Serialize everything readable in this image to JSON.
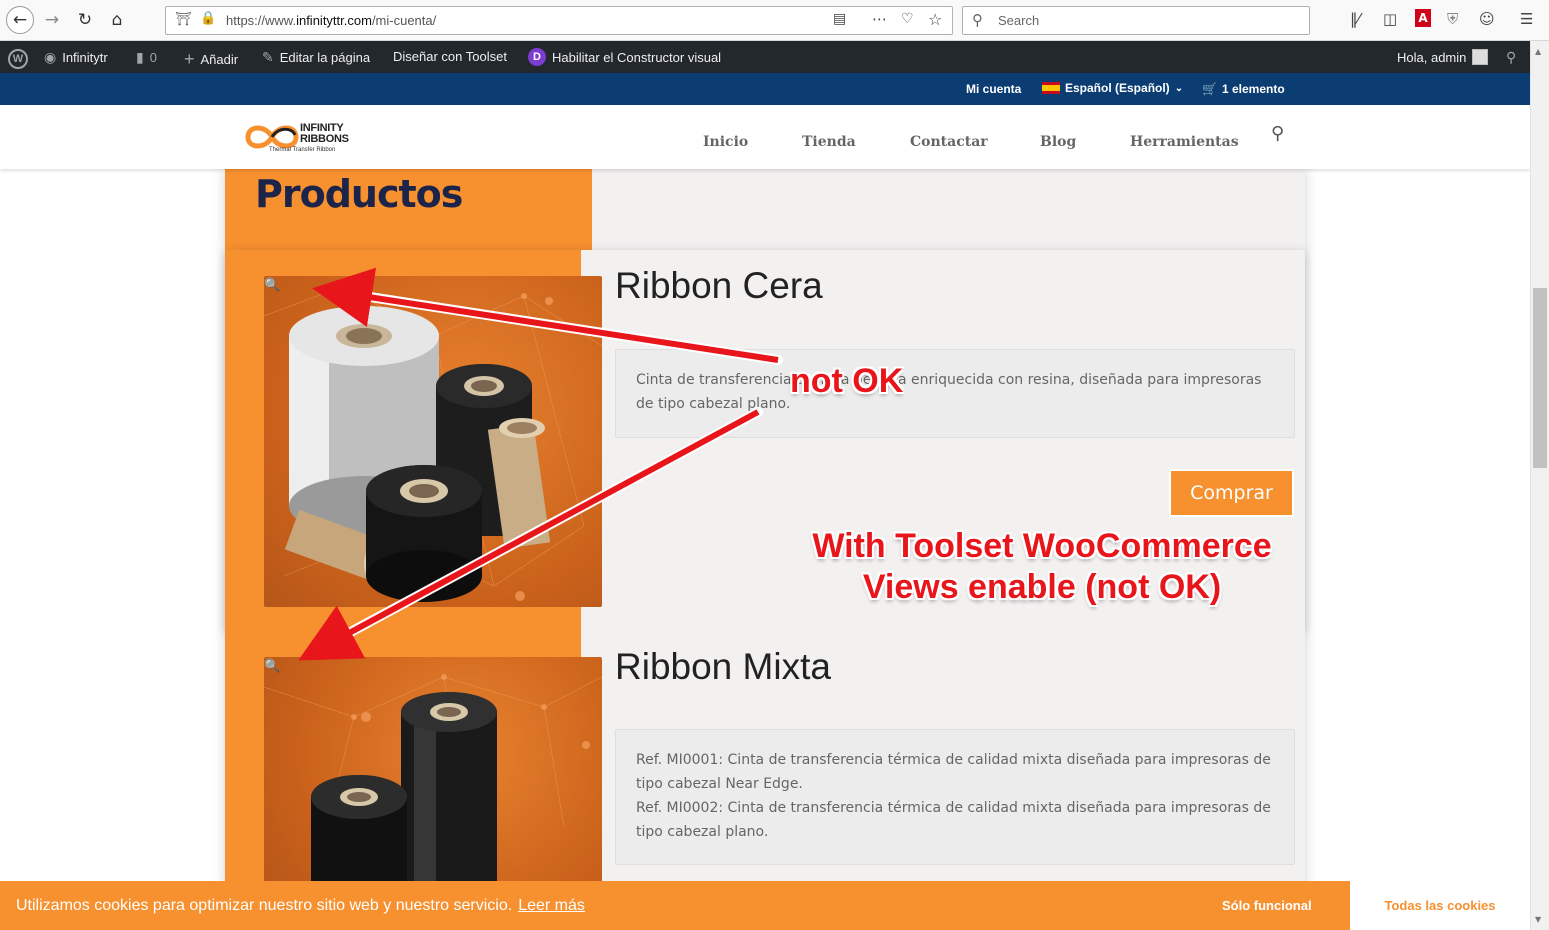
{
  "browser": {
    "url_prefix": "https://www.",
    "url_host": "infinityttr.com",
    "url_path": "/mi-cuenta/",
    "search_placeholder": "Search"
  },
  "admin_bar": {
    "site_name": "Infinitytr",
    "comments_count": "0",
    "add_label": "Añadir",
    "edit_label": "Editar la página",
    "design_label": "Diseñar con Toolset",
    "visual_builder_label": "Habilitar el Constructor visual",
    "greeting": "Hola, admin"
  },
  "top_bar": {
    "account_link": "Mi cuenta",
    "language": "Español (Español)",
    "cart": "1 elemento"
  },
  "header": {
    "logo_name": "INFINITY\nRIBBONS",
    "logo_tagline": "Thermal Transfer Ribbon",
    "nav": [
      "Inicio",
      "Tienda",
      "Contactar",
      "Blog",
      "Herramientas"
    ]
  },
  "page": {
    "title": "Productos",
    "products": [
      {
        "title": "Ribbon Cera",
        "description": "Cinta de transferencia térmica de cera enriquecida con resina, diseñada para impresoras de tipo cabezal plano.",
        "buy_label": "Comprar"
      },
      {
        "title": "Ribbon Mixta",
        "description_lines": [
          "Ref. MI0001: Cinta de transferencia térmica de calidad mixta diseñada para impresoras de tipo cabezal Near Edge.",
          "Ref. MI0002: Cinta de transferencia térmica de calidad mixta diseñada para impresoras de tipo cabezal plano."
        ]
      }
    ]
  },
  "annotations": {
    "label_1": "not OK",
    "label_2_line1": "With Toolset WooCommerce",
    "label_2_line2": "Views enable (not OK)",
    "color": "#e8151b"
  },
  "cookie_banner": {
    "message": "Utilizamos cookies para optimizar nuestro sitio web y nuestro servicio.",
    "link": "Leer más",
    "functional_button": "Sólo funcional",
    "all_button": "Todas las cookies"
  },
  "colors": {
    "brand_orange": "#f7902f",
    "top_bar_blue": "#0b3d72",
    "admin_bar": "#23282d",
    "title_navy": "#1c2449"
  }
}
